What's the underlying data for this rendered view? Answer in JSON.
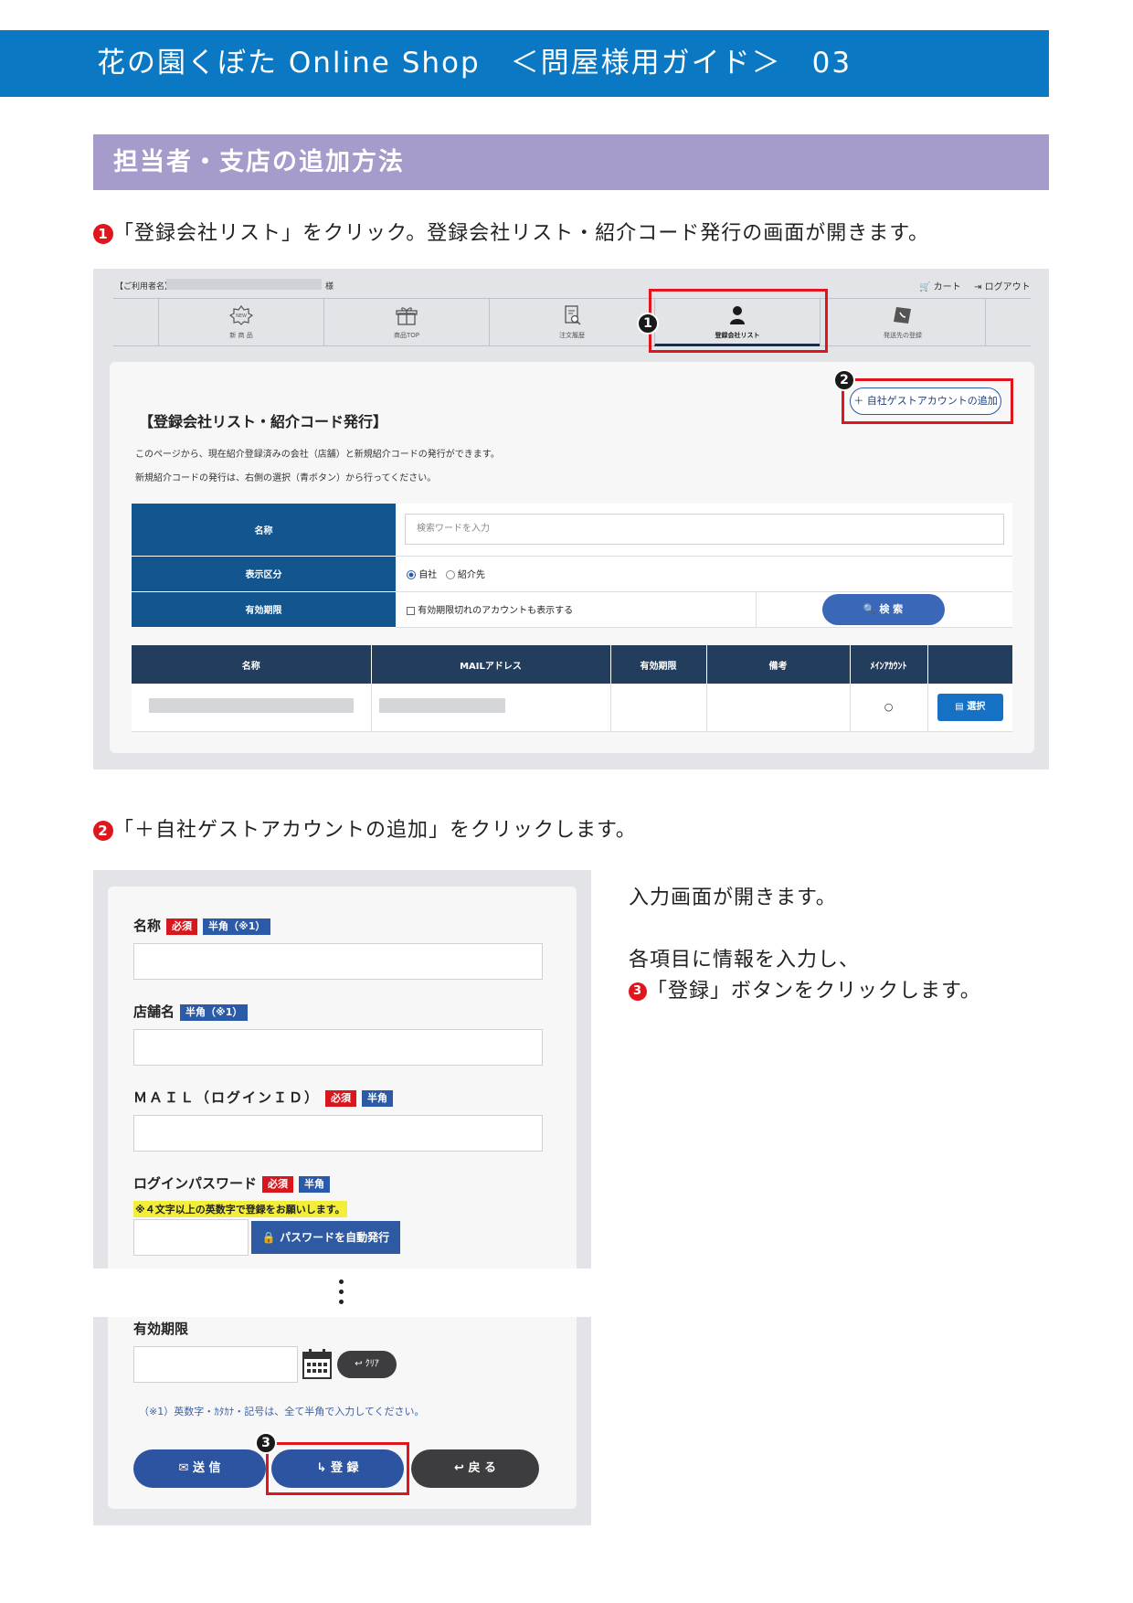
{
  "header": {
    "title": "花の園くぼた Online Shop　＜問屋様用ガイド＞　03"
  },
  "section": {
    "title": "担当者・支店の追加方法"
  },
  "steps": {
    "step1_num": "1",
    "step1_text": "「登録会社リスト」をクリック。登録会社リスト・紹介コード発行の画面が開きます。",
    "step2_num": "2",
    "step2_text": "「＋自社ゲストアカウントの追加」をクリックします。",
    "right_line1": "入力画面が開きます。",
    "right_line2": "各項目に情報を入力し、",
    "step3_num": "3",
    "right_line3": "「登録」ボタンをクリックします。"
  },
  "shot1": {
    "user_label": "【ご利用者名】",
    "user_suffix": "様",
    "cart_label": "カート",
    "logout_label": "ログアウト",
    "nav": [
      {
        "label": "新 商 品"
      },
      {
        "label": "商品TOP"
      },
      {
        "label": "注文履歴"
      },
      {
        "label": "登録会社リスト"
      },
      {
        "label": "発送先の登録"
      }
    ],
    "add_button": "＋ 自社ゲストアカウントの追加",
    "panel_title": "【登録会社リスト・紹介コード発行】",
    "desc1": "このページから、現在紹介登録済みの会社（店舗）と新規紹介コードの発行ができます。",
    "desc2": "新規紹介コードの発行は、右側の選択（青ボタン）から行ってください。",
    "form": {
      "name_label": "名称",
      "name_placeholder": "検索ワードを入力",
      "type_label": "表示区分",
      "type_opt1": "自社",
      "type_opt2": "紹介先",
      "expiry_label": "有効期限",
      "expiry_check": "有効期限切れのアカウントも表示する",
      "search_button": "検 索"
    },
    "list": {
      "columns": [
        "名称",
        "MAILアドレス",
        "有効期限",
        "備考",
        "ﾒｲﾝｱｶｳﾝﾄ",
        ""
      ],
      "row_main_mark": "○",
      "select_button": "選択"
    }
  },
  "shot2": {
    "name_label": "名称",
    "req_tag": "必須",
    "half_tag_note": "半角（※1）",
    "half_tag": "半角",
    "store_label": "店舗名",
    "mail_label": "ＭＡＩＬ（ログインＩＤ）",
    "pw_label": "ログインパスワード",
    "pw_note": "※４文字以上の英数字で登録をお願いします。",
    "pw_button": "パスワードを自動発行",
    "expiry_label": "有効期限",
    "clear_button": "ｸﾘｱ",
    "footnote": "（※1）英数字・ｶﾀｶﾅ・記号は、全て半角で入力してください。",
    "send_button": "送 信",
    "register_button": "登 録",
    "back_button": "戻 る"
  },
  "colors": {
    "header_blue": "#0a78c2",
    "section_purple": "#a79bcc",
    "highlight_red": "#e0161e",
    "table_blue": "#13558f",
    "table_dark": "#233d5c"
  }
}
